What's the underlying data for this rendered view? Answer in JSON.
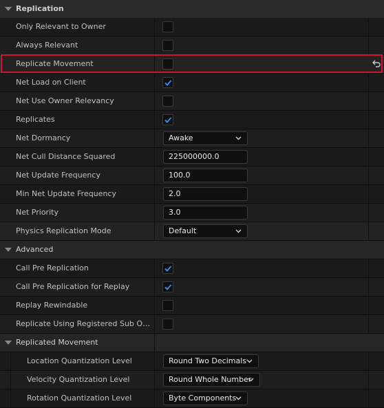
{
  "section": {
    "title": "Replication"
  },
  "properties": [
    {
      "label": "Only Relevant to Owner",
      "checked": false
    },
    {
      "label": "Always Relevant",
      "checked": false
    },
    {
      "label": "Replicate Movement",
      "checked": false
    },
    {
      "label": "Net Load on Client",
      "checked": true
    },
    {
      "label": "Net Use Owner Relevancy",
      "checked": false
    },
    {
      "label": "Replicates",
      "checked": true
    },
    {
      "label": "Net Dormancy",
      "value": "Awake"
    },
    {
      "label": "Net Cull Distance Squared",
      "value": "225000000.0"
    },
    {
      "label": "Net Update Frequency",
      "value": "100.0"
    },
    {
      "label": "Min Net Update Frequency",
      "value": "2.0"
    },
    {
      "label": "Net Priority",
      "value": "3.0"
    },
    {
      "label": "Physics Replication Mode",
      "value": "Default"
    }
  ],
  "advanced": {
    "title": "Advanced",
    "items": [
      {
        "label": "Call Pre Replication",
        "checked": true
      },
      {
        "label": "Call Pre Replication for Replay",
        "checked": true
      },
      {
        "label": "Replay Rewindable",
        "checked": false
      },
      {
        "label": "Replicate Using Registered Sub Objec...",
        "checked": false
      }
    ]
  },
  "replicated_movement": {
    "title": "Replicated Movement",
    "items": [
      {
        "label": "Location Quantization Level",
        "value": "Round Two Decimals"
      },
      {
        "label": "Velocity Quantization Level",
        "value": "Round Whole Number"
      },
      {
        "label": "Rotation Quantization Level",
        "value": "Byte Components"
      }
    ]
  },
  "icons": {
    "collapse": "chevron-down-icon",
    "checkmark": "checkmark-icon",
    "reset": "reset-to-default-icon"
  },
  "colors": {
    "accent_check": "#2f8be6",
    "highlight_border": "#d2142c"
  }
}
